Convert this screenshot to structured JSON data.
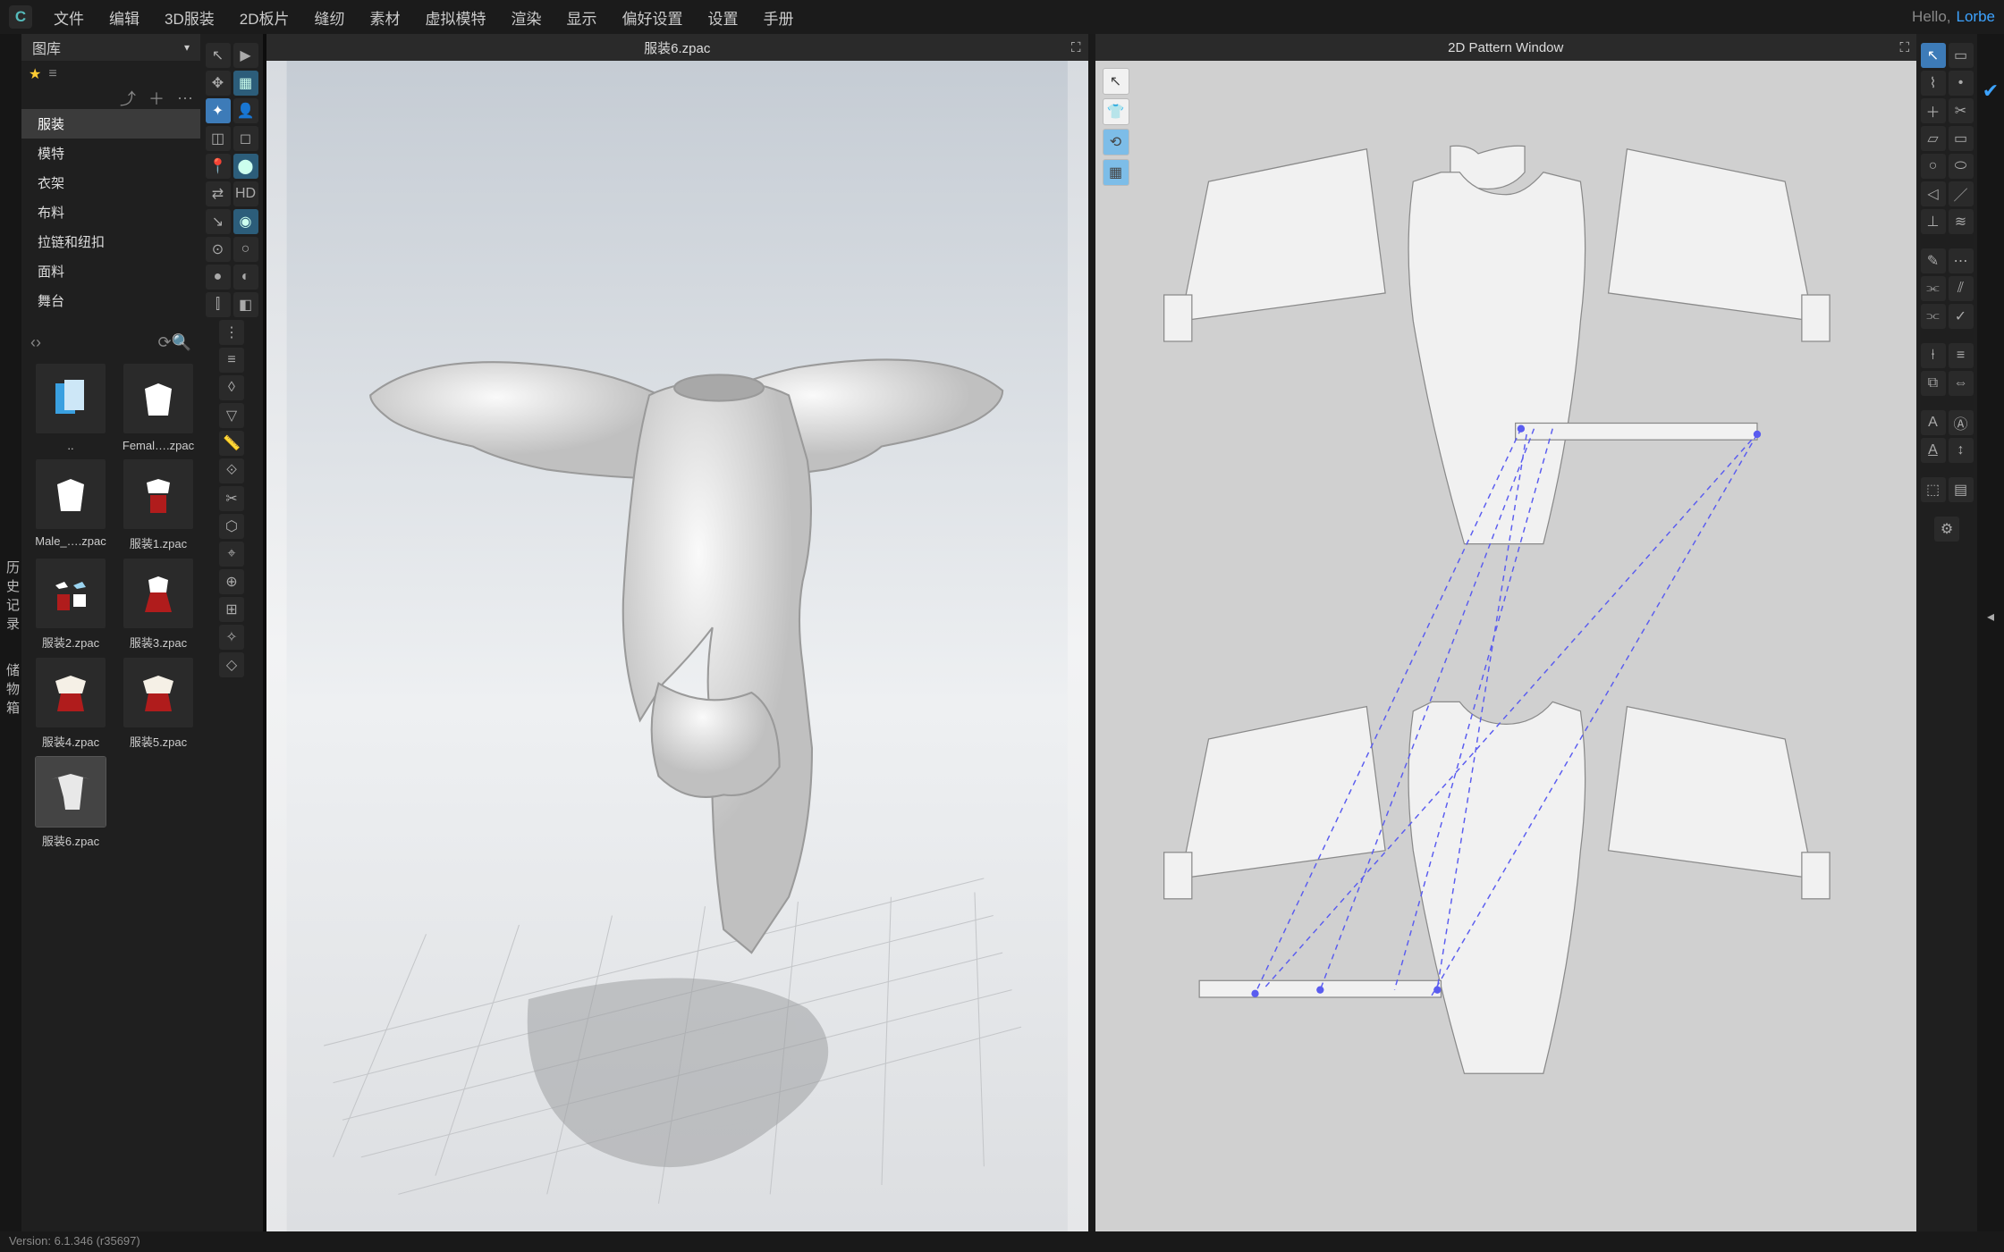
{
  "menu": {
    "items": [
      "文件",
      "编辑",
      "3D服装",
      "2D板片",
      "缝纫",
      "素材",
      "虚拟模特",
      "渲染",
      "显示",
      "偏好设置",
      "设置",
      "手册"
    ]
  },
  "greeting": {
    "hello": "Hello,",
    "user": "Lorbe"
  },
  "vtabs": [
    "历史记录",
    "储物箱"
  ],
  "library": {
    "title": "图库"
  },
  "categories": [
    "服装",
    "模特",
    "衣架",
    "布料",
    "拉链和纽扣",
    "面料",
    "舞台"
  ],
  "assets": [
    {
      "label": ".."
    },
    {
      "label": "Femal….zpac",
      "shirt": "#fff"
    },
    {
      "label": "Male_….zpac",
      "shirt": "#fff"
    },
    {
      "label": "服装1.zpac",
      "outfit": "r1"
    },
    {
      "label": "服装2.zpac",
      "outfit": "r2"
    },
    {
      "label": "服装3.zpac",
      "outfit": "r3"
    },
    {
      "label": "服装4.zpac",
      "outfit": "r4"
    },
    {
      "label": "服装5.zpac",
      "outfit": "r5"
    },
    {
      "label": "服装6.zpac",
      "sel": true,
      "outfit": "r6"
    }
  ],
  "viewport3d": {
    "title": "服装6.zpac"
  },
  "viewport2d": {
    "title": "2D Pattern Window"
  },
  "status": {
    "version": "Version: 6.1.346 (r35697)"
  },
  "colors": {
    "sew": "#5a5cf0"
  }
}
